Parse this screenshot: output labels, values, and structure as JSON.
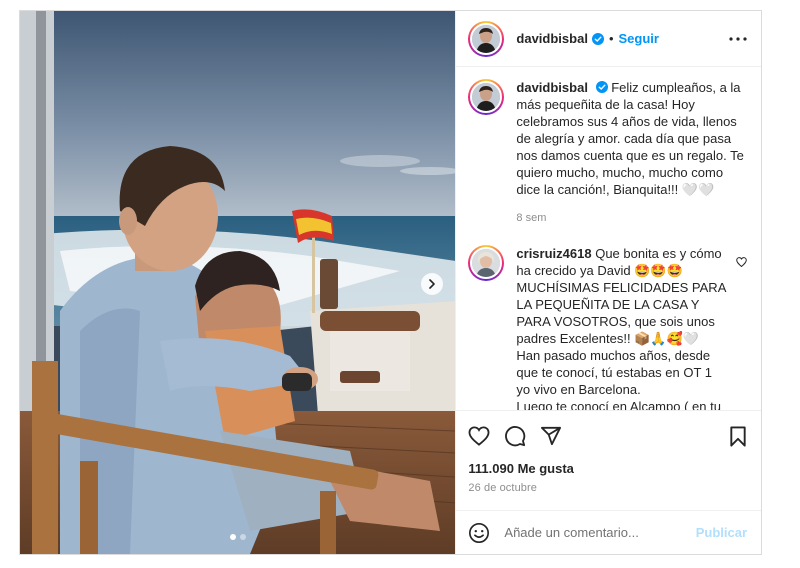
{
  "post": {
    "author": "davidbisbal",
    "separator": "•",
    "follow_label": "Seguir",
    "caption": "Feliz cumpleaños, a la más pequeñita de la casa! Hoy celebramos sus 4 años de vida, llenos de alegría y amor. cada día que pasa nos damos cuenta que es un regalo. Te quiero mucho, mucho, mucho como dice la canción!, Bianquita!!! 🤍🤍",
    "caption_time": "8 sem",
    "likes": "111.090 Me gusta",
    "date": "26 de octubre",
    "carousel_index": 1,
    "carousel_total": 2
  },
  "comments": [
    {
      "user": "crisruiz4618",
      "text": "Que bonita es y cómo ha crecido ya David 🤩🤩🤩 MUCHÍSIMAS FELICIDADES PARA LA PEQUEÑITA DE LA CASA Y PARA VOSOTROS, que sois unos padres Excelentes!! 📦🙏🥰🤍\nHan pasado muchos años, desde que te conocí, tú estabas en OT 1 yo vivo en Barcelona.\nLuego te conocí en Alcampo ( en tu primera firma de discos ). Tú Música"
    }
  ],
  "comment_box": {
    "placeholder": "Añade un comentario...",
    "publish_label": "Publicar"
  },
  "icons": {
    "verified": "verified-badge-icon",
    "more": "more-options-icon",
    "like": "heart-icon",
    "comment": "comment-icon",
    "share": "paper-plane-icon",
    "save": "bookmark-icon",
    "emoji": "emoji-smile-icon",
    "next": "chevron-right-icon"
  },
  "colors": {
    "accent": "#0095f6",
    "publish_disabled": "#b2dffc",
    "verified": "#0095f6",
    "muted_text": "#8e8e8e"
  }
}
